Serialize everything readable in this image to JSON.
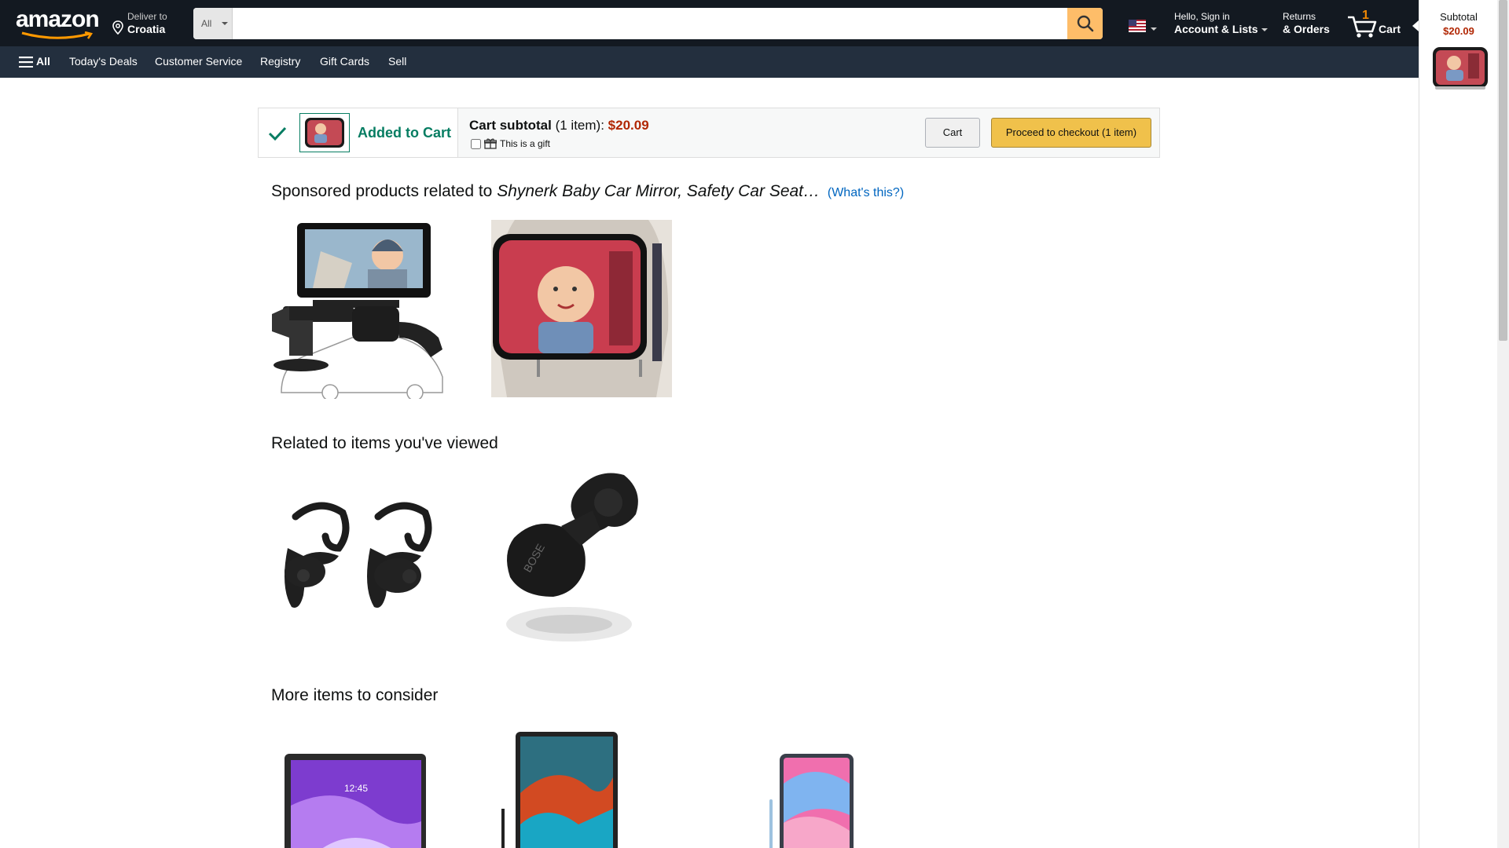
{
  "header": {
    "logo_text": "amazon",
    "deliver_small": "Deliver to",
    "deliver_big": "Croatia",
    "search_category": "All",
    "search_placeholder": "",
    "account_small": "Hello, Sign in",
    "account_big": "Account & Lists",
    "returns_small": "Returns",
    "returns_big": "& Orders",
    "cart_count": "1",
    "cart_label": "Cart"
  },
  "subnav": {
    "all_label": "All",
    "items": [
      "Today's Deals",
      "Customer Service",
      "Registry",
      "Gift Cards",
      "Sell"
    ]
  },
  "side_panel": {
    "subtotal_label": "Subtotal",
    "subtotal_value": "$20.09"
  },
  "added_bar": {
    "added_text": "Added to Cart",
    "subtotal_label": "Cart subtotal",
    "items_count": "(1 item):",
    "subtotal_value": "$20.09",
    "gift_label": "This is a gift",
    "cart_button": "Cart",
    "checkout_button": "Proceed to checkout (1 item)"
  },
  "sections": {
    "sponsored_prefix": "Sponsored products related to",
    "sponsored_product": "Shynerk Baby Car Mirror, Safety Car Seat…",
    "whats_this": "(What's this?)",
    "related_title": "Related to items you've viewed",
    "more_title": "More items to consider",
    "tablet_time": "12:45"
  },
  "colors": {
    "nav_bg": "#131921",
    "subnav_bg": "#232f3e",
    "search_btn": "#febd69",
    "added_green": "#067d62",
    "price_red": "#b12704",
    "checkout_yellow": "#f0c14b",
    "link_blue": "#0066c0"
  }
}
